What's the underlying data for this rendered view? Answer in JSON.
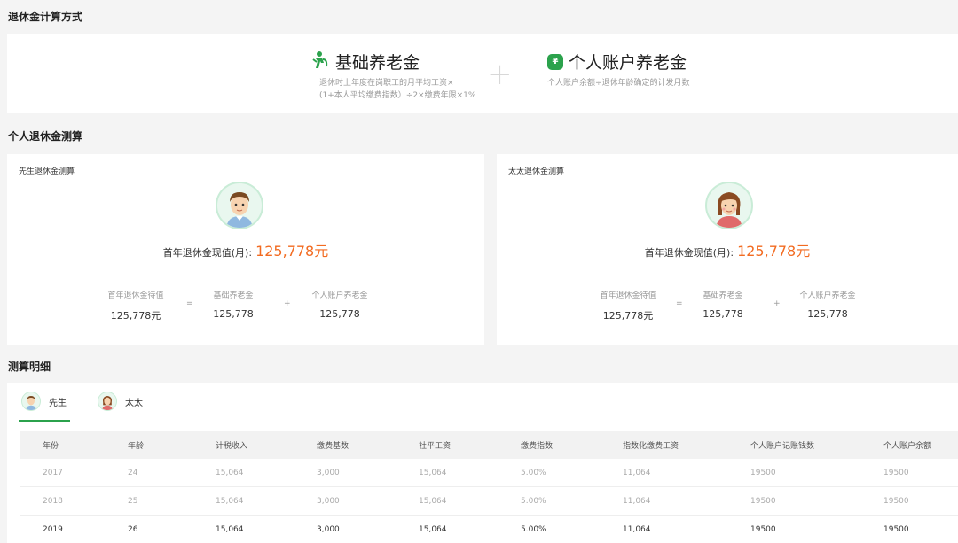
{
  "sections": {
    "formula_title": "退休金计算方式",
    "estimate_title": "个人退休金测算",
    "detail_title": "测算明细"
  },
  "formula": {
    "basic": {
      "title": "基础养老金",
      "desc_line1": "退休时上年度在岗职工的月平均工资×",
      "desc_line2": "(1+本人平均缴费指数）÷2×缴费年限×1%"
    },
    "plus": "+",
    "personal": {
      "title": "个人账户养老金",
      "desc": "个人账户余额÷退休年龄确定的计发月数",
      "icon_glyph": "¥"
    }
  },
  "husband": {
    "title": "先生退休金测算",
    "first_year_label": "首年退休金现值(月):",
    "first_year_value": "125,778元",
    "total_label": "首年退休金待值",
    "total_value": "125,778元",
    "basic_label": "基础养老金",
    "basic_value": "125,778",
    "personal_label": "个人账户养老金",
    "personal_value": "125,778",
    "eq": "=",
    "plus": "+"
  },
  "wife": {
    "title": "太太退休金测算",
    "first_year_label": "首年退休金现值(月):",
    "first_year_value": "125,778元",
    "total_label": "首年退休金待值",
    "total_value": "125,778元",
    "basic_label": "基础养老金",
    "basic_value": "125,778",
    "personal_label": "个人账户养老金",
    "personal_value": "125,778",
    "eq": "=",
    "plus": "+"
  },
  "tabs": [
    {
      "label": "先生",
      "active": true
    },
    {
      "label": "太太",
      "active": false
    }
  ],
  "table": {
    "headers": [
      "年份",
      "年龄",
      "计税收入",
      "缴费基数",
      "社平工资",
      "缴费指数",
      "指数化缴费工资",
      "个人账户记账钱数",
      "个人账户余额"
    ],
    "rows": [
      [
        "2017",
        "24",
        "15,064",
        "3,000",
        "15,064",
        "5.00%",
        "11,064",
        "19500",
        "19500"
      ],
      [
        "2018",
        "25",
        "15,064",
        "3,000",
        "15,064",
        "5.00%",
        "11,064",
        "19500",
        "19500"
      ],
      [
        "2019",
        "26",
        "15,064",
        "3,000",
        "15,064",
        "5.00%",
        "11,064",
        "19500",
        "19500"
      ]
    ]
  },
  "colors": {
    "accent": "#2ba24c",
    "highlight": "#f26b21"
  }
}
